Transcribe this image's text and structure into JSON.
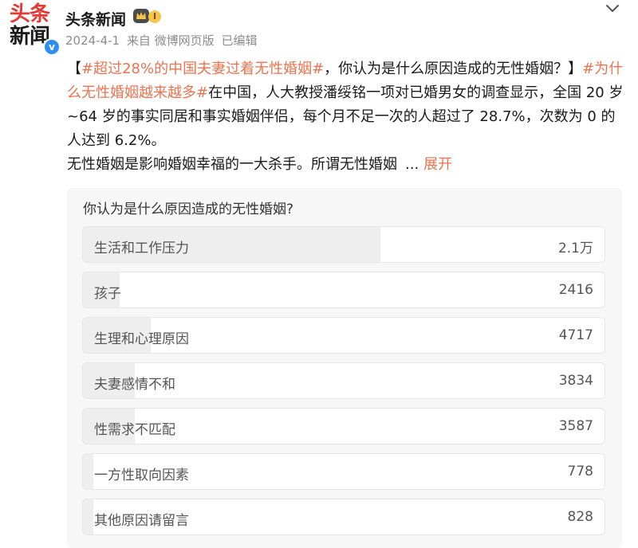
{
  "author": {
    "avatar_line1": "头条",
    "avatar_line2": "新闻",
    "name": "头条新闻",
    "level": "I",
    "verified_mark": "v"
  },
  "meta": {
    "date": "2024-4-1",
    "source": "来自 微博网页版",
    "edited": "已编辑"
  },
  "post": {
    "bracket_open": "【",
    "hashtag1": "#超过28%的中国夫妻过着无性婚姻#",
    "question": "，你认为是什么原因造成的无性婚姻？】",
    "hashtag2": "#为什么无性婚姻越来越多#",
    "body1": "在中国，人大教授潘绥铭一项对已婚男女的调查显示，全国 20 岁~64 岁的事实同居和事实婚姻伴侣，每个月不足一次的人超过了 28.7%，次数为 0 的人达到 6.2%。",
    "body2": "无性婚姻是影响婚姻幸福的一大杀手。所谓无性婚姻",
    "ellipsis": "...",
    "expand": "展开"
  },
  "poll": {
    "question": "你认为是什么原因造成的无性婚姻?",
    "options": [
      {
        "label": "生活和工作压力",
        "count": "2.1万",
        "share": 0.57
      },
      {
        "label": "孩子",
        "count": "2416",
        "share": 0.07
      },
      {
        "label": "生理和心理原因",
        "count": "4717",
        "share": 0.13
      },
      {
        "label": "夫妻感情不和",
        "count": "3834",
        "share": 0.1
      },
      {
        "label": "性需求不匹配",
        "count": "3587",
        "share": 0.1
      },
      {
        "label": "一方性取向因素",
        "count": "778",
        "share": 0.02
      },
      {
        "label": "其他原因请留言",
        "count": "828",
        "share": 0.02
      }
    ]
  },
  "colors": {
    "accent": "#eb7350",
    "verified": "#2f8df4",
    "bar_fill": "#eeeeee"
  },
  "icons": {
    "more": "chevron-down-icon",
    "badge": "crown-icon"
  }
}
